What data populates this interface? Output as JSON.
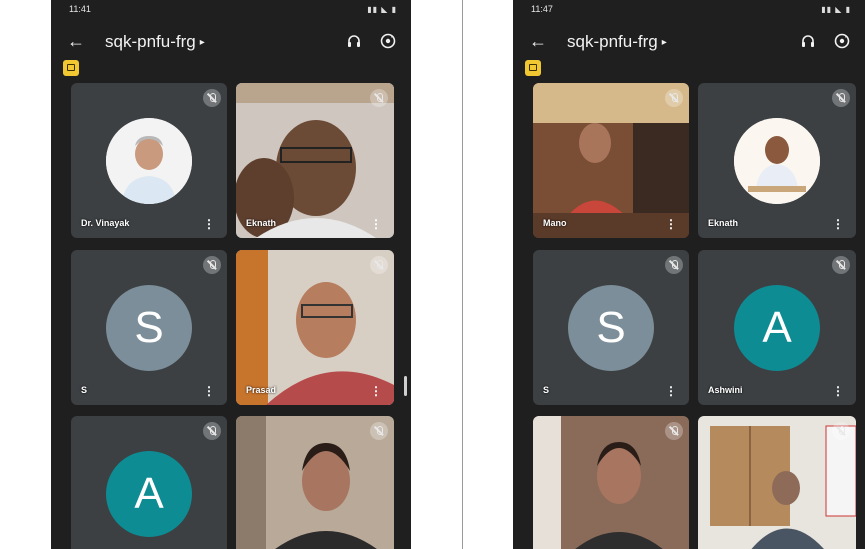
{
  "left": {
    "status": {
      "time": "11:41",
      "icons": "▮▮ ◣ ▮"
    },
    "header": {
      "back": "←",
      "meeting_code": "sqk-pnfu-frg",
      "caret": "▸"
    },
    "tiles": [
      {
        "name": "Dr. Vinayak",
        "type": "photo-avatar"
      },
      {
        "name": "Eknath",
        "type": "video"
      },
      {
        "name": "S",
        "type": "initial",
        "initial": "S",
        "color": "#7c8e99"
      },
      {
        "name": "Prasad",
        "type": "video"
      },
      {
        "name": "",
        "type": "initial",
        "initial": "A",
        "color": "#0e8c93"
      },
      {
        "name": "",
        "type": "video"
      }
    ]
  },
  "right": {
    "status": {
      "time": "11:47",
      "icons": "▮▮ ◣ ▮"
    },
    "header": {
      "back": "←",
      "meeting_code": "sqk-pnfu-frg",
      "caret": "▸"
    },
    "tiles": [
      {
        "name": "Mano",
        "type": "video"
      },
      {
        "name": "Eknath",
        "type": "photo-avatar"
      },
      {
        "name": "S",
        "type": "initial",
        "initial": "S",
        "color": "#7c8e99"
      },
      {
        "name": "Ashwini",
        "type": "initial",
        "initial": "A",
        "color": "#0e8c93"
      },
      {
        "name": "",
        "type": "video"
      },
      {
        "name": "",
        "type": "video"
      }
    ]
  },
  "icons": {
    "mute": "microphone-off-icon",
    "more": "more-vertical-icon",
    "headphones": "headphones-icon",
    "switch_camera": "switch-camera-icon",
    "present": "presentation-icon"
  },
  "colors": {
    "background": "#1f1f1f",
    "tile": "#3c4043",
    "highlight": "#5b8ee6",
    "badge": "#f2c832"
  }
}
